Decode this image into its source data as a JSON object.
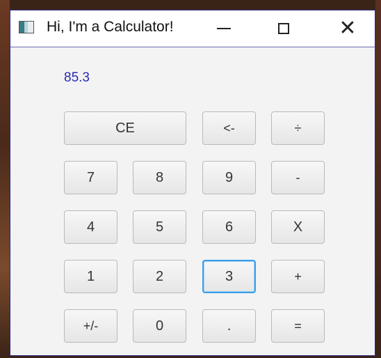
{
  "window": {
    "title": "Hi, I'm a Calculator!",
    "controls": {
      "minimize": "—",
      "maximize": "☐",
      "close": "✕"
    }
  },
  "display": {
    "value": "85.3"
  },
  "keypad": {
    "row1": [
      "CE",
      "<-",
      "÷"
    ],
    "row2": [
      "7",
      "8",
      "9",
      "-"
    ],
    "row3": [
      "4",
      "5",
      "6",
      "X"
    ],
    "row4": [
      "1",
      "2",
      "3",
      "+"
    ],
    "row5": [
      "+/-",
      "0",
      ".",
      "="
    ]
  },
  "colors": {
    "display_text": "#2a2ab8",
    "focus_ring": "#3d9ee8",
    "window_border": "#2f2a8a"
  }
}
